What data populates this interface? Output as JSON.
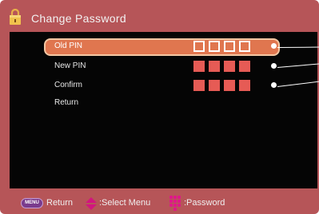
{
  "header": {
    "title": "Change Password",
    "icon": "lock-icon"
  },
  "menu": {
    "rows": [
      {
        "label": "Old PIN",
        "selected": true,
        "pin_style": "outline",
        "digits": 4
      },
      {
        "label": "New PIN",
        "selected": false,
        "pin_style": "filled",
        "digits": 4
      },
      {
        "label": "Confirm",
        "selected": false,
        "pin_style": "filled",
        "digits": 4
      }
    ],
    "return_label": "Return"
  },
  "footer": {
    "menu_key_label": "MENU",
    "return_label": "Return",
    "select_label": ":Select Menu",
    "password_label": ":Password",
    "icons": [
      "menu-key-icon",
      "up-down-arrows-icon",
      "number-keypad-icon"
    ]
  },
  "colors": {
    "panel": "#b65558",
    "content": "#050505",
    "selection": "#e0764f",
    "selection_border": "#f4c7a3",
    "pin_filled": "#e65b55",
    "menu_key": "#7a3b8d",
    "keypad": "#e0168a"
  }
}
